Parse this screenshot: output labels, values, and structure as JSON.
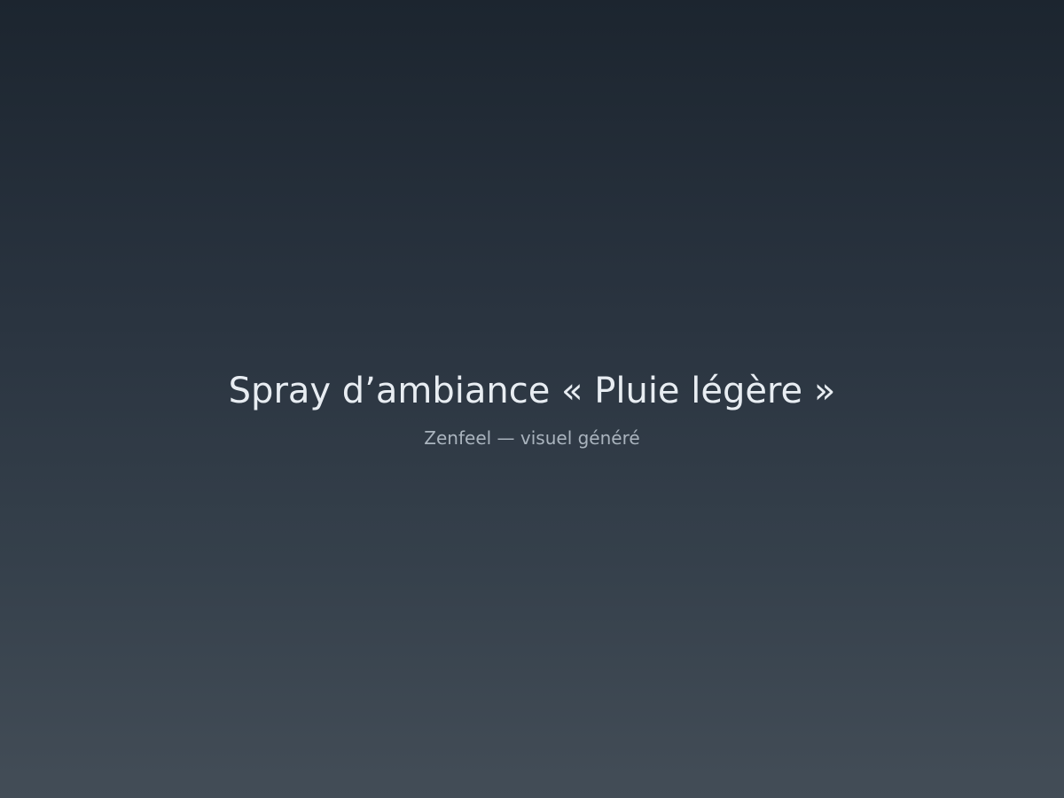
{
  "visual": {
    "title": "Spray d’ambiance « Pluie légère »",
    "subtitle": "Zenfeel — visuel généré"
  },
  "colors": {
    "background_top": "#1c252f",
    "background_bottom": "#434d57",
    "title_text": "#e8edf2",
    "subtitle_text": "#aab4be"
  }
}
